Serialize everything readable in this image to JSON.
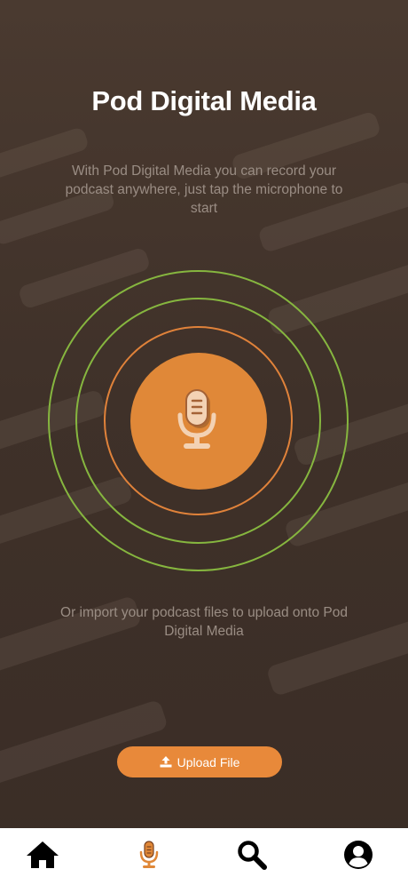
{
  "app": {
    "title": "Pod Digital Media",
    "intro": "With Pod Digital Media you can record your podcast anywhere, just tap the microphone to start",
    "import_text": "Or import your podcast files to upload onto Pod Digital Media"
  },
  "record": {
    "icon": "microphone-icon"
  },
  "upload": {
    "label": "Upload File",
    "icon": "upload-icon"
  },
  "nav": {
    "items": [
      {
        "name": "home",
        "icon": "home-icon",
        "active": false
      },
      {
        "name": "record",
        "icon": "microphone-icon",
        "active": true
      },
      {
        "name": "search",
        "icon": "search-icon",
        "active": false
      },
      {
        "name": "profile",
        "icon": "user-circle-icon",
        "active": false
      }
    ]
  },
  "colors": {
    "background": "#3f3129",
    "accent": "#e08838",
    "ring_green": "#86b63f",
    "ring_orange": "#e0823a",
    "nav_background": "#ffffff",
    "nav_active": "#e08838"
  }
}
